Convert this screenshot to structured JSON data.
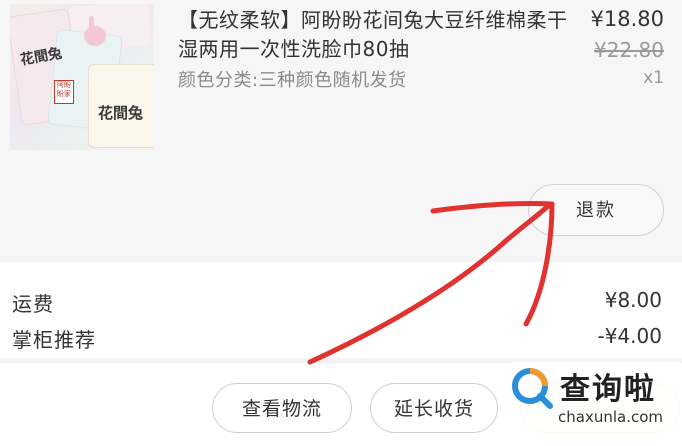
{
  "product": {
    "title": "【无纹柔软】阿盼盼花间兔大豆纤维棉柔干湿两用一次性洗脸巾80抽",
    "sku": "颜色分类:三种颜色随机发货",
    "price": "¥18.80",
    "original_price": "¥22.80",
    "quantity": "x1",
    "image_brand_text": "花間兔",
    "image_seal_text": "阿盼盼家",
    "refund_label": "退款"
  },
  "fees": {
    "shipping_label": "运费",
    "shipping_value": "¥8.00",
    "shop_rec_label": "掌柜推荐",
    "shop_rec_value": "-¥4.00"
  },
  "actions": {
    "logistics_label": "查看物流",
    "extend_label": "延长收货"
  },
  "watermark": {
    "main": "查询啦",
    "sub": "chaxunla.com"
  },
  "colors": {
    "annotation": "#e0322f",
    "watermark_orange": "#f39a2b",
    "watermark_blue": "#2a8fd8"
  }
}
